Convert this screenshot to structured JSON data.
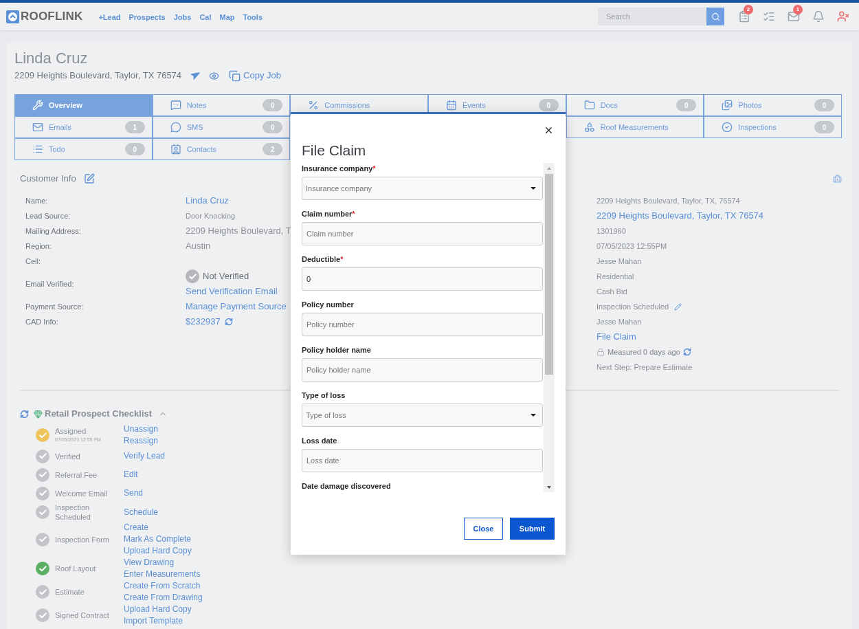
{
  "header": {
    "logo": "ROOFLINK",
    "nav": [
      "+Lead",
      "Prospects",
      "Jobs",
      "Cal",
      "Map",
      "Tools"
    ],
    "search": {
      "placeholder": "Search"
    },
    "tasks_badge": "2",
    "mail_badge": "1"
  },
  "job": {
    "name": "Linda Cruz",
    "address": "2209 Heights Boulevard, Taylor, TX 76574",
    "copy_label": "Copy Job"
  },
  "tabs": [
    {
      "label": "Overview",
      "selected": true
    },
    {
      "label": "Notes",
      "count": "0",
      "selected": false
    },
    {
      "label": "Commissions",
      "selected": false
    },
    {
      "label": "Events",
      "count": "0",
      "selected": false
    },
    {
      "label": "Docs",
      "count": "0",
      "selected": false
    },
    {
      "label": "Photos",
      "count": "0",
      "selected": false
    },
    {
      "label": "Emails",
      "count": "1",
      "selected": false
    },
    {
      "label": "SMS",
      "count": "0",
      "selected": false
    },
    {
      "label": "Roof Measurements",
      "selected": false
    },
    {
      "label": "Inspections",
      "count": "0",
      "selected": false
    },
    {
      "label": "Todo",
      "count": "0",
      "selected": false
    },
    {
      "label": "Contacts",
      "count": "2",
      "selected": false
    }
  ],
  "customer_info": {
    "title": "Customer Info",
    "rows": [
      {
        "label": "Name:",
        "values": [
          {
            "kind": "link",
            "text": "Linda Cruz"
          }
        ]
      },
      {
        "label": "Lead Source:",
        "values": [
          {
            "kind": "small",
            "text": "Door Knocking"
          }
        ]
      },
      {
        "label": "Mailing Address:",
        "values": [
          {
            "kind": "text",
            "text": "2209 Heights Boulevard, T"
          }
        ]
      },
      {
        "label": "Region:",
        "values": [
          {
            "kind": "text",
            "text": "Austin"
          }
        ]
      },
      {
        "label": "Cell:",
        "values": []
      },
      {
        "label": "Email Verified:",
        "values": [
          {
            "kind": "status",
            "text": "Not Verified",
            "verified": false
          },
          {
            "kind": "link",
            "text": "Send Verification Email"
          }
        ]
      },
      {
        "label": "Payment Source:",
        "values": [
          {
            "kind": "link",
            "text": "Manage Payment Source"
          }
        ]
      },
      {
        "label": "CAD Info:",
        "values": [
          {
            "kind": "refresh_link",
            "text": "$232937"
          }
        ]
      }
    ]
  },
  "job_details": [
    {
      "kind": "small",
      "text": "2209 Heights Boulevard, Taylor, TX, 76574"
    },
    {
      "kind": "link",
      "text": "2209 Heights Boulevard, Taylor, TX 76574"
    },
    {
      "kind": "small",
      "text": "1301960"
    },
    {
      "kind": "small",
      "text": "07/05/2023 12:55PM"
    },
    {
      "kind": "small",
      "text": "Jesse Mahan"
    },
    {
      "kind": "small",
      "text": "Residential"
    },
    {
      "kind": "small",
      "text": "Cash Bid"
    },
    {
      "kind": "edit",
      "text": "Inspection Scheduled"
    },
    {
      "kind": "small",
      "text": "Jesse Mahan"
    },
    {
      "kind": "link",
      "text": "File Claim"
    },
    {
      "kind": "measured",
      "text": "Measured 0 days ago"
    },
    {
      "kind": "small",
      "text": "Next Step: Prepare Estimate"
    }
  ],
  "checklist": {
    "title": "Retail Prospect Checklist",
    "expanded": true,
    "items": [
      {
        "label": "Assigned",
        "sublabel": "07/05/2023 12:55 PM",
        "color": "#f0c45c",
        "actions": [
          "Unassign",
          "Reassign"
        ]
      },
      {
        "label": "Verified",
        "color": "#c2c4c7",
        "actions": [
          "Verify Lead"
        ]
      },
      {
        "label": "Referral Fee",
        "color": "#c2c4c7",
        "actions": [
          "Edit"
        ]
      },
      {
        "label": "Welcome Email",
        "color": "#c2c4c7",
        "actions": [
          "Send"
        ]
      },
      {
        "label": "Inspection Scheduled",
        "color": "#c2c4c7",
        "actions": [
          "Schedule"
        ]
      },
      {
        "label": "Inspection Form",
        "color": "#c2c4c7",
        "actions": [
          "Create",
          "Mark As Complete",
          "Upload Hard Copy"
        ]
      },
      {
        "label": "Roof Layout",
        "color": "#5cb063",
        "actions": [
          "View Drawing",
          "Enter Measurements"
        ]
      },
      {
        "label": "Estimate",
        "color": "#c2c4c7",
        "actions": [
          "Create From Scratch",
          "Create From Drawing"
        ]
      },
      {
        "label": "Signed Contract",
        "color": "#c2c4c7",
        "actions": [
          "Upload Hard Copy",
          "Import Template"
        ]
      }
    ]
  },
  "modal": {
    "title": "File Claim",
    "required_mark": "*",
    "fields": [
      {
        "label": "Insurance company",
        "required": true,
        "kind": "select",
        "placeholder": "Insurance company"
      },
      {
        "label": "Claim number",
        "required": true,
        "kind": "input",
        "placeholder": "Claim number"
      },
      {
        "label": "Deductible",
        "required": true,
        "kind": "input",
        "value": "0"
      },
      {
        "label": "Policy number",
        "required": false,
        "kind": "input",
        "placeholder": "Policy number"
      },
      {
        "label": "Policy holder name",
        "required": false,
        "kind": "input",
        "placeholder": "Policy holder name"
      },
      {
        "label": "Type of loss",
        "required": false,
        "kind": "select",
        "placeholder": "Type of loss"
      },
      {
        "label": "Loss date",
        "required": false,
        "kind": "input",
        "placeholder": "Loss date"
      },
      {
        "label": "Date damage discovered",
        "required": false,
        "kind": "label"
      }
    ],
    "buttons": [
      {
        "label": "Close",
        "kind": "secondary"
      },
      {
        "label": "Submit",
        "kind": "primary"
      }
    ]
  }
}
